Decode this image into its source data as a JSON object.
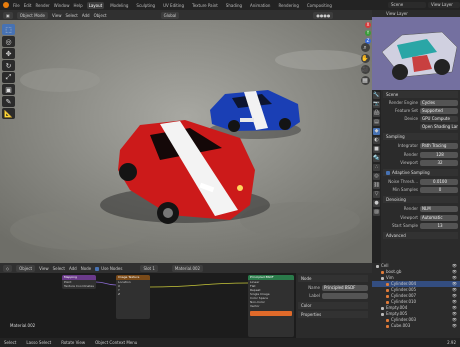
{
  "menu": {
    "items": [
      "File",
      "Edit",
      "Render",
      "Window",
      "Help"
    ],
    "workspaces": [
      "Layout",
      "Modeling",
      "Sculpting",
      "UV Editing",
      "Texture Paint",
      "Shading",
      "Animation",
      "Rendering",
      "Compositing"
    ],
    "scene": "Scene",
    "view_layer": "View Layer"
  },
  "viewport_header": {
    "mode": "Object Mode",
    "menus": [
      "View",
      "Select",
      "Add",
      "Object"
    ],
    "orientation": "Global"
  },
  "tools": [
    "cursor",
    "select-box",
    "move",
    "rotate",
    "scale",
    "transform",
    "annotate",
    "measure"
  ],
  "gizmo": {
    "x": "X",
    "y": "Y",
    "z": "Z"
  },
  "properties": {
    "section_title": "Scene",
    "render_engine_label": "Render Engine",
    "render_engine": "Cycles",
    "feature_set_label": "Feature Set",
    "feature_set": "Supported",
    "device_label": "Device",
    "device": "GPU Compute",
    "shading_system": "Open Shading Language",
    "sampling": "Sampling",
    "integrator_label": "Integrator",
    "integrator": "Path Tracing",
    "render_label": "Render",
    "render_samples": "128",
    "viewport_label": "Viewport",
    "viewport_samples": "32",
    "adaptive": "Adaptive Sampling",
    "noise_label": "Noise Thresh...",
    "noise": "0.0100",
    "min_samples_label": "Min Samples",
    "min_samples": "0",
    "denoising": "Denoising",
    "dn_render_label": "Render",
    "dn_render": "NLM",
    "dn_viewport_label": "Viewport",
    "dn_viewport": "Automatic",
    "start_label": "Start Sample",
    "start": "13",
    "advanced": "Advanced"
  },
  "node_editor": {
    "header_items": [
      "Object",
      "View",
      "Select",
      "Add",
      "Node",
      "Use Nodes",
      "Slot 1",
      "Material.002"
    ],
    "material_label": "Material.002",
    "panel_tab": "Node",
    "name_label": "Name",
    "name_value": "Principled BSDF",
    "label_label": "Label",
    "color_label": "Color",
    "properties_label": "Properties",
    "node1_title": "Mapping",
    "node1_rows": [
      "Point",
      "Texture Coordinates"
    ],
    "node2_title": "Image Texture",
    "node2_rows": [
      "Location",
      "X",
      "Y",
      "Z"
    ],
    "node3_title": "Principled BSDF",
    "node3_rows": [
      "Linear",
      "Flat",
      "Repeat",
      "Single Image",
      "Color Space",
      "Non-Color",
      "Vector"
    ]
  },
  "outliner": {
    "items": [
      {
        "name": "Cell",
        "indent": 0,
        "color": "#bbbbbb"
      },
      {
        "name": "boot.gb",
        "indent": 1,
        "color": "#e07b39"
      },
      {
        "name": "Vim",
        "indent": 1,
        "color": "#bbbbbb"
      },
      {
        "name": "Cylinder.004",
        "indent": 2,
        "color": "#e07b39"
      },
      {
        "name": "Cylinder.005",
        "indent": 2,
        "color": "#e07b39"
      },
      {
        "name": "Cylinder.007",
        "indent": 2,
        "color": "#e07b39"
      },
      {
        "name": "Cylinder.010",
        "indent": 2,
        "color": "#e07b39"
      },
      {
        "name": "Empty.004",
        "indent": 1,
        "color": "#bbbbbb"
      },
      {
        "name": "Empty.005",
        "indent": 1,
        "color": "#bbbbbb"
      },
      {
        "name": "Cylinder.003",
        "indent": 2,
        "color": "#e07b39"
      },
      {
        "name": "Cube.003",
        "indent": 2,
        "color": "#e07b39"
      }
    ]
  },
  "status": {
    "select": "Select",
    "box_select": "Lasso Select",
    "rotate": "Rotate View",
    "context": "Object Context Menu",
    "version": "2.92"
  },
  "colors": {
    "accent": "#4772b3",
    "car_red": "#cc1a1a",
    "car_blue": "#1a3fb5",
    "ground": "#8e8e88"
  }
}
